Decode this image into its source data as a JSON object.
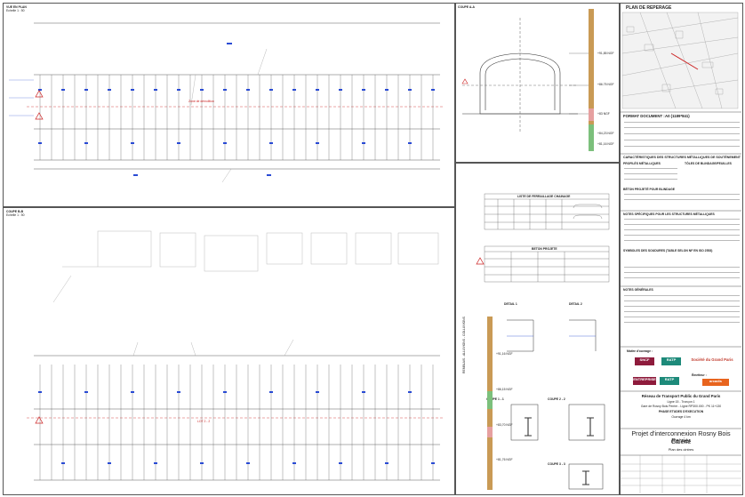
{
  "views": {
    "plan_title": "VUE EN PLAN",
    "plan_scale": "Echelle 1 : 50",
    "coupe_aa": "COUPE A-A",
    "coupe_bb": "COUPE B-B",
    "coupe_bb_scale": "Echelle 1 : 50",
    "detail1": "DETAIL 1",
    "detail2": "DETAIL 2",
    "coupe_1": "COUPE 1 - 1",
    "coupe_2": "COUPE 2 - 2",
    "coupe_3": "COUPE 3 - 3"
  },
  "labels": {
    "ngf_values": [
      "+91,85 NGF",
      "+86.75 NGF",
      "+83 NGF",
      "+84,23 NGF",
      "+81,16 NGF",
      "+91,16 NGF",
      "+86,15 NGF",
      "+83,70 NGF",
      "+81,76 NGF"
    ],
    "remblai": "REMBLAIS - ALLUVIONS - COLLUVIONS",
    "chainage": "Zone de démolition",
    "lot": "LOT 2 - 2"
  },
  "ferraillage": {
    "title": "LISTE DE FERRAILLAGE CHAINAGE",
    "beton_title": "BETON PROJETE"
  },
  "cartouche": {
    "plan_repere": "PLAN DE REPERAGE",
    "format_label": "FORMAT DOCUMENT :",
    "format_value": "A0 (1189*841)",
    "charac_title": "CARACTÉRISTIQUES DES STRUCTURES MÉTALLIQUES DE SOUTÈNEMENT",
    "profiles_title": "PROFILÉS MÉTALLIQUES",
    "toles_title": "TÔLES DE BLINDAGE/FEUILLES",
    "beton_projete": "BÉTON PROJETÉ POUR BLINDAGE",
    "notes_specifiques": "NOTES SPÉCIFIQUES POUR LES STRUCTURES MÉTALLIQUES",
    "symboles": "SYMBOLES DES SOUDURES (TABLE SELON NF EN ISO 2553)",
    "notes_generales": "NOTES GÉNÉRALES",
    "maitre_ouvrage": "Maître d'ouvrage :",
    "societe": "Société du Grand Paris",
    "emetteur": "Émetteur :",
    "rtpgp": "Réseau de Transport Public du Grand Paris",
    "ligne": "Ligne 15 - Tronçon 1",
    "gare": "Gare de Rosny Bois Perrier - Ligne RP300.000 - PK 11+130",
    "phase": "PHASE ETUDES D'EXECUTION",
    "ouvrage": "Ouvrage 4 km",
    "projet": "Projet d'interconnexion Rosny Bois Perrier",
    "galerie": "Galerie",
    "plan_cintres": "Plan des cintres",
    "logo_a": "SNCF",
    "logo_b": "RATP",
    "logo_c": "ENTREPRISE",
    "logo_d": "arcadis"
  },
  "colors": {
    "accent_blue": "#2a4bd4",
    "hazard_red": "#cc2222",
    "strip_brown": "#c99a55",
    "strip_green": "#7cc07c",
    "strip_pink": "#e6a0a0"
  }
}
